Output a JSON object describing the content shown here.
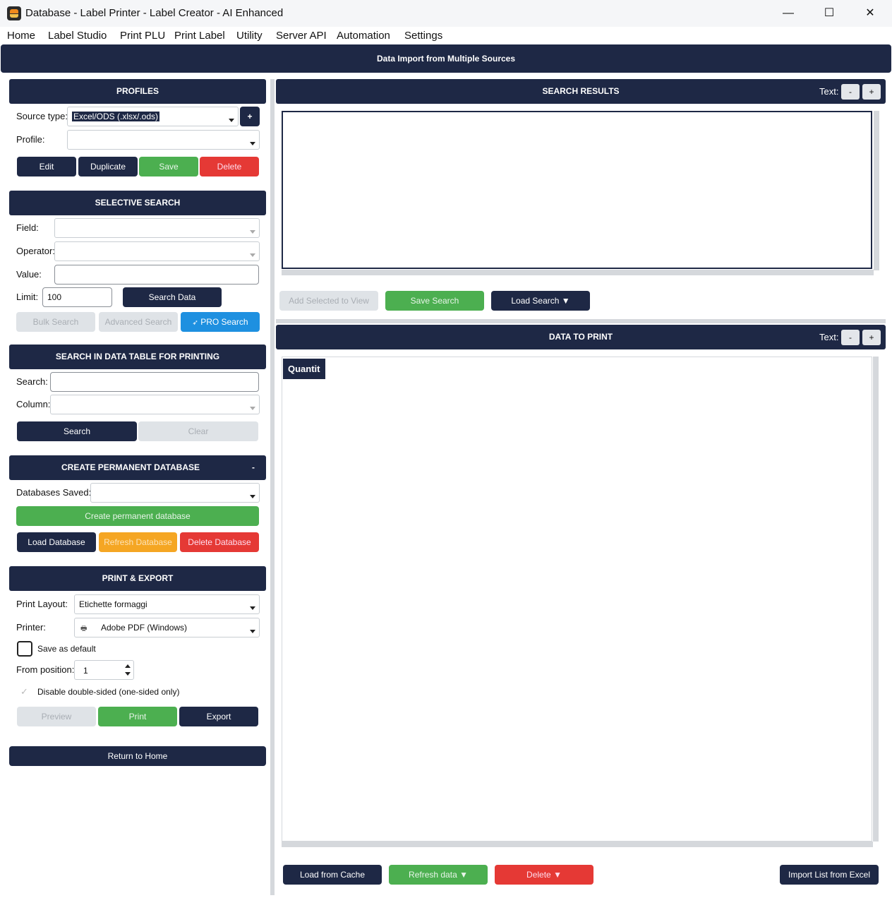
{
  "window": {
    "title": "Database - Label Printer - Label Creator - AI Enhanced",
    "minimize": "—",
    "maximize": "☐",
    "close": "✕"
  },
  "menu": [
    "Home",
    "Label Studio",
    "Print PLU",
    "Print Label",
    "Utility",
    "Server API",
    "Automation",
    "Settings"
  ],
  "header": {
    "title": "Data Import from Multiple Sources"
  },
  "profiles": {
    "title": "PROFILES",
    "source_type_label": "Source type:",
    "source_type_value": "Excel/ODS (.xlsx/.ods)",
    "add_label": "+",
    "profile_label": "Profile:",
    "profile_value": "",
    "edit": "Edit",
    "duplicate": "Duplicate",
    "save": "Save",
    "delete": "Delete"
  },
  "selective_search": {
    "title": "SELECTIVE SEARCH",
    "field_label": "Field:",
    "operator_label": "Operator:",
    "value_label": "Value:",
    "limit_label": "Limit:",
    "limit_value": "100",
    "search_data": "Search Data",
    "bulk_search": "Bulk Search",
    "advanced_search": "Advanced Search",
    "pro_search": "PRO Search"
  },
  "table_search": {
    "title": "SEARCH IN DATA TABLE FOR PRINTING",
    "search_label": "Search:",
    "column_label": "Column:",
    "search_btn": "Search",
    "clear_btn": "Clear"
  },
  "permanent_db": {
    "title": "CREATE PERMANENT DATABASE",
    "collapse": "-",
    "saved_label": "Databases Saved:",
    "create_btn": "Create permanent database",
    "load_btn": "Load Database",
    "refresh_btn": "Refresh Database",
    "delete_btn": "Delete Database"
  },
  "print_export": {
    "title": "PRINT & EXPORT",
    "layout_label": "Print Layout:",
    "layout_value": "Etichette formaggi",
    "printer_label": "Printer:",
    "printer_value": "Adobe PDF (Windows)",
    "save_default": "Save as default",
    "from_position_label": "From position:",
    "from_position_value": "1",
    "disable_double": "Disable double-sided (one-sided only)",
    "check_mark": "✓",
    "preview": "Preview",
    "print": "Print",
    "export": "Export"
  },
  "return_home": "Return to Home",
  "search_results": {
    "title": "SEARCH RESULTS",
    "text_label": "Text:",
    "minus": "-",
    "plus": "+",
    "add_selected": "Add Selected to View",
    "save_search": "Save Search",
    "load_search": "Load Search ▼"
  },
  "data_to_print": {
    "title": "DATA TO PRINT",
    "text_label": "Text:",
    "minus": "-",
    "plus": "+",
    "column_header": "Quantit",
    "load_cache": "Load from Cache",
    "refresh": "Refresh data ▼",
    "delete": "Delete ▼",
    "import_excel": "Import List from Excel"
  }
}
